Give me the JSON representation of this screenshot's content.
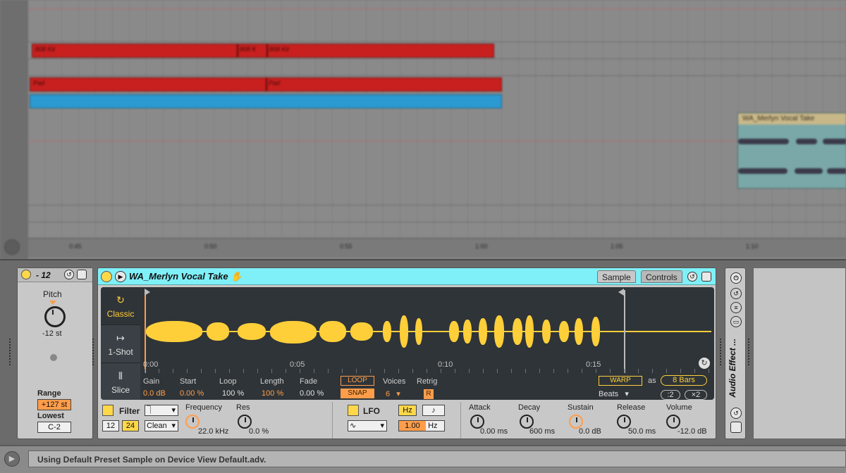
{
  "arrangement": {
    "clips_row1": [
      "808 Kit",
      "808 K",
      "808 Kit"
    ],
    "clips_row2": [
      "Pad",
      "Pad"
    ],
    "vocal_clip": "WA_Merlyn Vocal Take",
    "ruler_ticks": [
      "0:45",
      "0:50",
      "0:55",
      "1:00",
      "1:05",
      "1:10"
    ]
  },
  "rack": {
    "name": "- 12",
    "pitch_label": "Pitch",
    "pitch_value": "-12 st",
    "range_label": "Range",
    "range_value": "+127 st",
    "lowest_label": "Lowest",
    "lowest_value": "C-2"
  },
  "simpler": {
    "name": "WA_Merlyn Vocal Take",
    "tabs": {
      "sample": "Sample",
      "controls": "Controls"
    },
    "modes": {
      "classic": "Classic",
      "one_shot": "1-Shot",
      "slice": "Slice"
    },
    "ruler": [
      "0:00",
      "0:05",
      "0:10",
      "0:15"
    ],
    "params": {
      "gain": {
        "label": "Gain",
        "value": "0.0 dB"
      },
      "start": {
        "label": "Start",
        "value": "0.00 %"
      },
      "loop": {
        "label": "Loop",
        "value": "100 %"
      },
      "length": {
        "label": "Length",
        "value": "100 %"
      },
      "fade": {
        "label": "Fade",
        "value": "0.00 %"
      },
      "loop_btn": "LOOP",
      "snap_btn": "SNAP",
      "voices": {
        "label": "Voices",
        "value": "6"
      },
      "retrig": {
        "label": "Retrig",
        "value": "R"
      }
    },
    "warp": {
      "button": "WARP",
      "as_label": "as",
      "bars": "8 Bars",
      "mode": "Beats",
      "half": ":2",
      "double": "×2"
    },
    "filter": {
      "label": "Filter",
      "slope_12": "12",
      "slope_24": "24",
      "circuit": "Clean",
      "frequency_label": "Frequency",
      "frequency_value": "22.0 kHz",
      "res_label": "Res",
      "res_value": "0.0 %"
    },
    "lfo": {
      "label": "LFO",
      "hz": "Hz",
      "note_icon": "♪",
      "rate": "1.00",
      "rate_unit": "Hz"
    },
    "envelope": {
      "attack": {
        "label": "Attack",
        "value": "0.00 ms"
      },
      "decay": {
        "label": "Decay",
        "value": "600 ms"
      },
      "sustain": {
        "label": "Sustain",
        "value": "0.0 dB"
      },
      "release": {
        "label": "Release",
        "value": "50.0 ms"
      },
      "volume": {
        "label": "Volume",
        "value": "-12.0 dB"
      }
    }
  },
  "fx_rack": {
    "label": "Audio Effect ..."
  },
  "status": {
    "text": "Using Default Preset Sample on Device View Default.adv."
  },
  "colors": {
    "accent_orange": "#ff9d4a",
    "waveform": "#ffcf3a",
    "title_cyan": "#7ff0f8",
    "clip_red": "#c8201e",
    "clip_blue": "#2a9ad0"
  }
}
